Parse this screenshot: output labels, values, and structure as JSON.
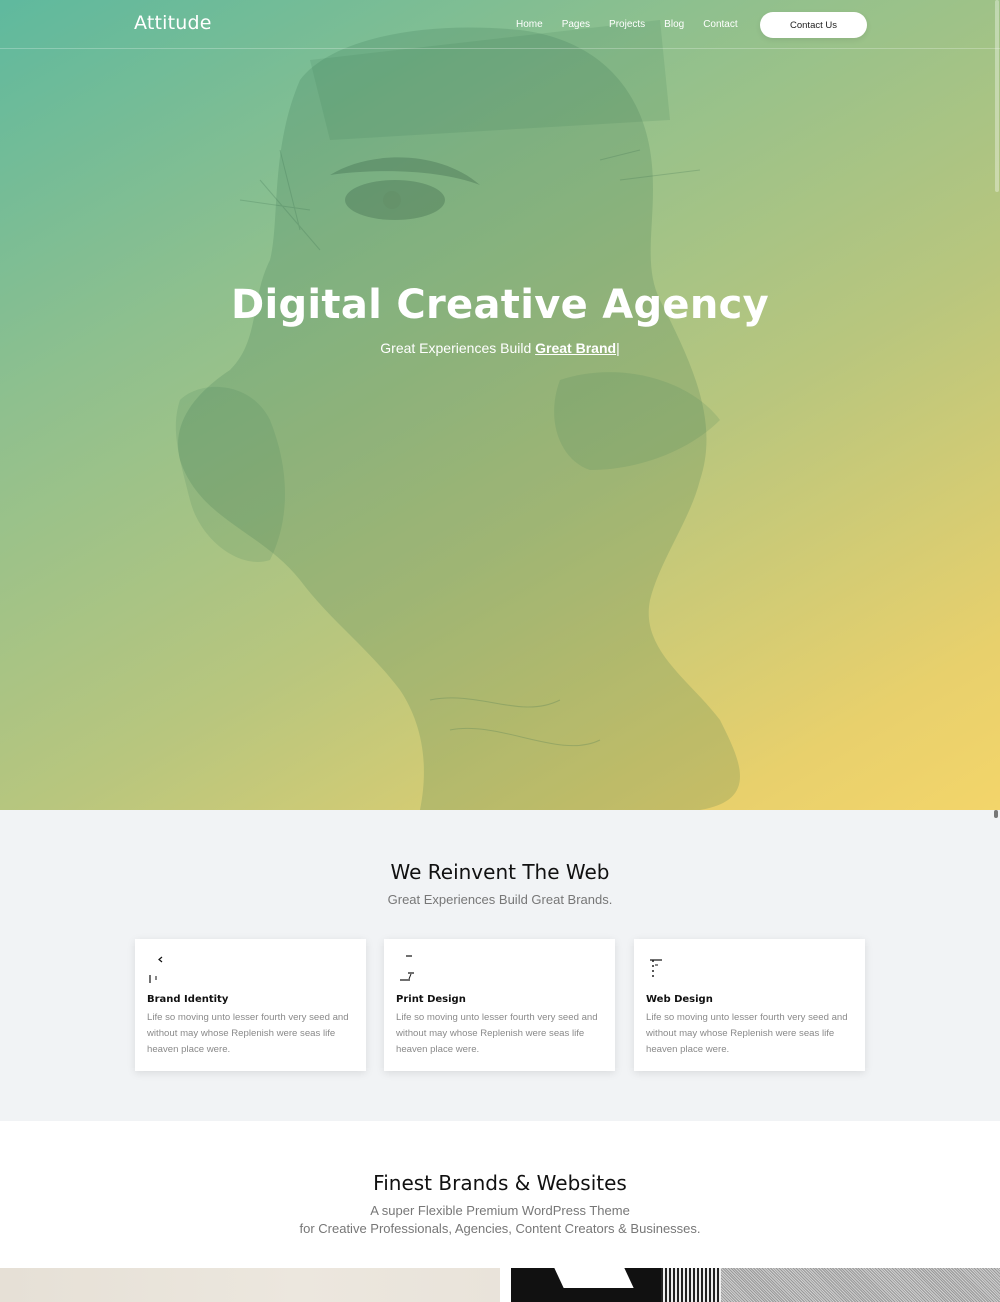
{
  "header": {
    "logo": "Attitude",
    "nav": [
      "Home",
      "Pages",
      "Projects",
      "Blog",
      "Contact"
    ],
    "cta": "Contact Us"
  },
  "hero": {
    "title": "Digital Creative Agency",
    "subtitle_prefix": "Great Experiences Build ",
    "subtitle_highlight": "Great Brand",
    "caret": "|",
    "gradient_start": "#5fb99e",
    "gradient_end": "#f3d56a"
  },
  "services": {
    "title": "We Reinvent The Web",
    "subtitle": "Great Experiences Build Great Brands.",
    "cards": [
      {
        "icon": "brand-identity-icon",
        "title": "Brand Identity",
        "text": "Life so moving unto lesser fourth very seed and without may whose Replenish were seas life heaven place were."
      },
      {
        "icon": "print-design-icon",
        "title": "Print Design",
        "text": "Life so moving unto lesser fourth very seed and without may whose Replenish were seas life heaven place were."
      },
      {
        "icon": "web-design-icon",
        "title": "Web Design",
        "text": "Life so moving unto lesser fourth very seed and without may whose Replenish were seas life heaven place were."
      }
    ]
  },
  "brands": {
    "title": "Finest Brands & Websites",
    "subtitle_line1": "A super Flexible Premium WordPress Theme",
    "subtitle_line2": "for Creative Professionals, Agencies, Content Creators & Businesses."
  }
}
